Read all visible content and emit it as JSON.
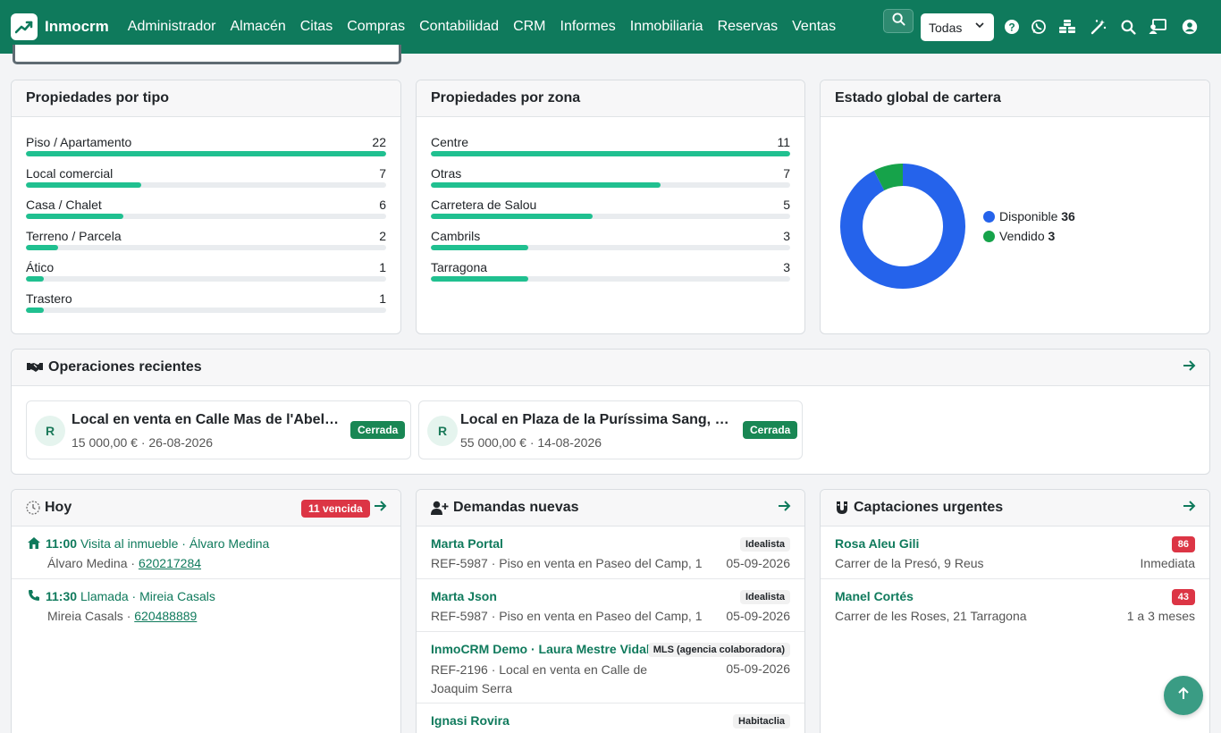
{
  "app": {
    "name": "Inmocrm"
  },
  "nav": [
    "Administrador",
    "Almacén",
    "Citas",
    "Compras",
    "Contabilidad",
    "CRM",
    "Informes",
    "Inmobiliaria",
    "Reservas",
    "Ventas"
  ],
  "filter": {
    "selected": "Todas"
  },
  "icons": [
    "search-icon",
    "chevron-down-icon",
    "help-icon",
    "whatsapp-icon",
    "cubes-icon",
    "magic-wand-icon",
    "search-icon",
    "user-screen-icon",
    "user-circle-icon"
  ],
  "por_tipo": {
    "title": "Propiedades por tipo",
    "items": [
      {
        "label": "Piso / Apartamento",
        "value": "22",
        "pct": 100
      },
      {
        "label": "Local comercial",
        "value": "7",
        "pct": 32
      },
      {
        "label": "Casa / Chalet",
        "value": "6",
        "pct": 27
      },
      {
        "label": "Terreno / Parcela",
        "value": "2",
        "pct": 9
      },
      {
        "label": "Ático",
        "value": "1",
        "pct": 5
      },
      {
        "label": "Trastero",
        "value": "1",
        "pct": 5
      }
    ]
  },
  "por_zona": {
    "title": "Propiedades por zona",
    "items": [
      {
        "label": "Centre",
        "value": "11",
        "pct": 100
      },
      {
        "label": "Otras",
        "value": "7",
        "pct": 64
      },
      {
        "label": "Carretera de Salou",
        "value": "5",
        "pct": 45
      },
      {
        "label": "Cambrils",
        "value": "3",
        "pct": 27
      },
      {
        "label": "Tarragona",
        "value": "3",
        "pct": 27
      }
    ]
  },
  "cartera": {
    "title": "Estado global de cartera",
    "legend": [
      {
        "label": "Disponible",
        "value": "36",
        "color": "#2563eb"
      },
      {
        "label": "Vendido",
        "value": "3",
        "color": "#16a34a"
      }
    ]
  },
  "chart_data": {
    "type": "pie",
    "title": "Estado global de cartera",
    "categories": [
      "Disponible",
      "Vendido"
    ],
    "values": [
      36,
      3
    ],
    "colors": [
      "#2563eb",
      "#16a34a"
    ],
    "legend": "right"
  },
  "operaciones": {
    "title": "Operaciones recientes",
    "items": [
      {
        "avatar": "R",
        "title": "Local en venta en Calle Mas de l'Abell...",
        "sub": "15 000,00 € · 26-08-2026",
        "badge": "Cerrada"
      },
      {
        "avatar": "R",
        "title": "Local en Plaza de la Puríssima Sang, Ce...",
        "sub": "55 000,00 € · 14-08-2026",
        "badge": "Cerrada"
      }
    ]
  },
  "hoy": {
    "title": "Hoy",
    "badge": "11 vencida",
    "items": [
      {
        "time": "11:00",
        "desc": "Visita al inmueble · Álvaro Medina",
        "person": "Álvaro Medina · ",
        "phone": "620217284"
      },
      {
        "time": "11:30",
        "desc": "Llamada · Mireia Casals",
        "person": "Mireia Casals · ",
        "phone": "620488889"
      }
    ]
  },
  "demandas": {
    "title": "Demandas nuevas",
    "items": [
      {
        "name": "Marta Portal",
        "source": "Idealista",
        "ref": "REF-5987 · Piso en venta en Paseo del Camp, 1",
        "ref2": "",
        "date": "05-09-2026"
      },
      {
        "name": "Marta Json",
        "source": "Idealista",
        "ref": "REF-5987 · Piso en venta en Paseo del Camp, 1",
        "ref2": "",
        "date": "05-09-2026"
      },
      {
        "name": "InmoCRM Demo · Laura Mestre Vidal",
        "source": "MLS (agencia colaboradora)",
        "ref": "REF-2196 · Local en venta en Calle de",
        "ref2": "Joaquim Serra",
        "date": "05-09-2026"
      },
      {
        "name": "Ignasi Rovira",
        "source": "Habitaclia",
        "ref": "",
        "ref2": "",
        "date": ""
      }
    ]
  },
  "captaciones": {
    "title": "Captaciones urgentes",
    "items": [
      {
        "name": "Rosa Aleu Gili",
        "score": "86",
        "address": "Carrer de la Presó, 9 Reus",
        "urgency": "Inmediata"
      },
      {
        "name": "Manel Cortés",
        "score": "43",
        "address": "Carrer de les Roses, 21 Tarragona",
        "urgency": "1 a 3 meses"
      }
    ]
  }
}
